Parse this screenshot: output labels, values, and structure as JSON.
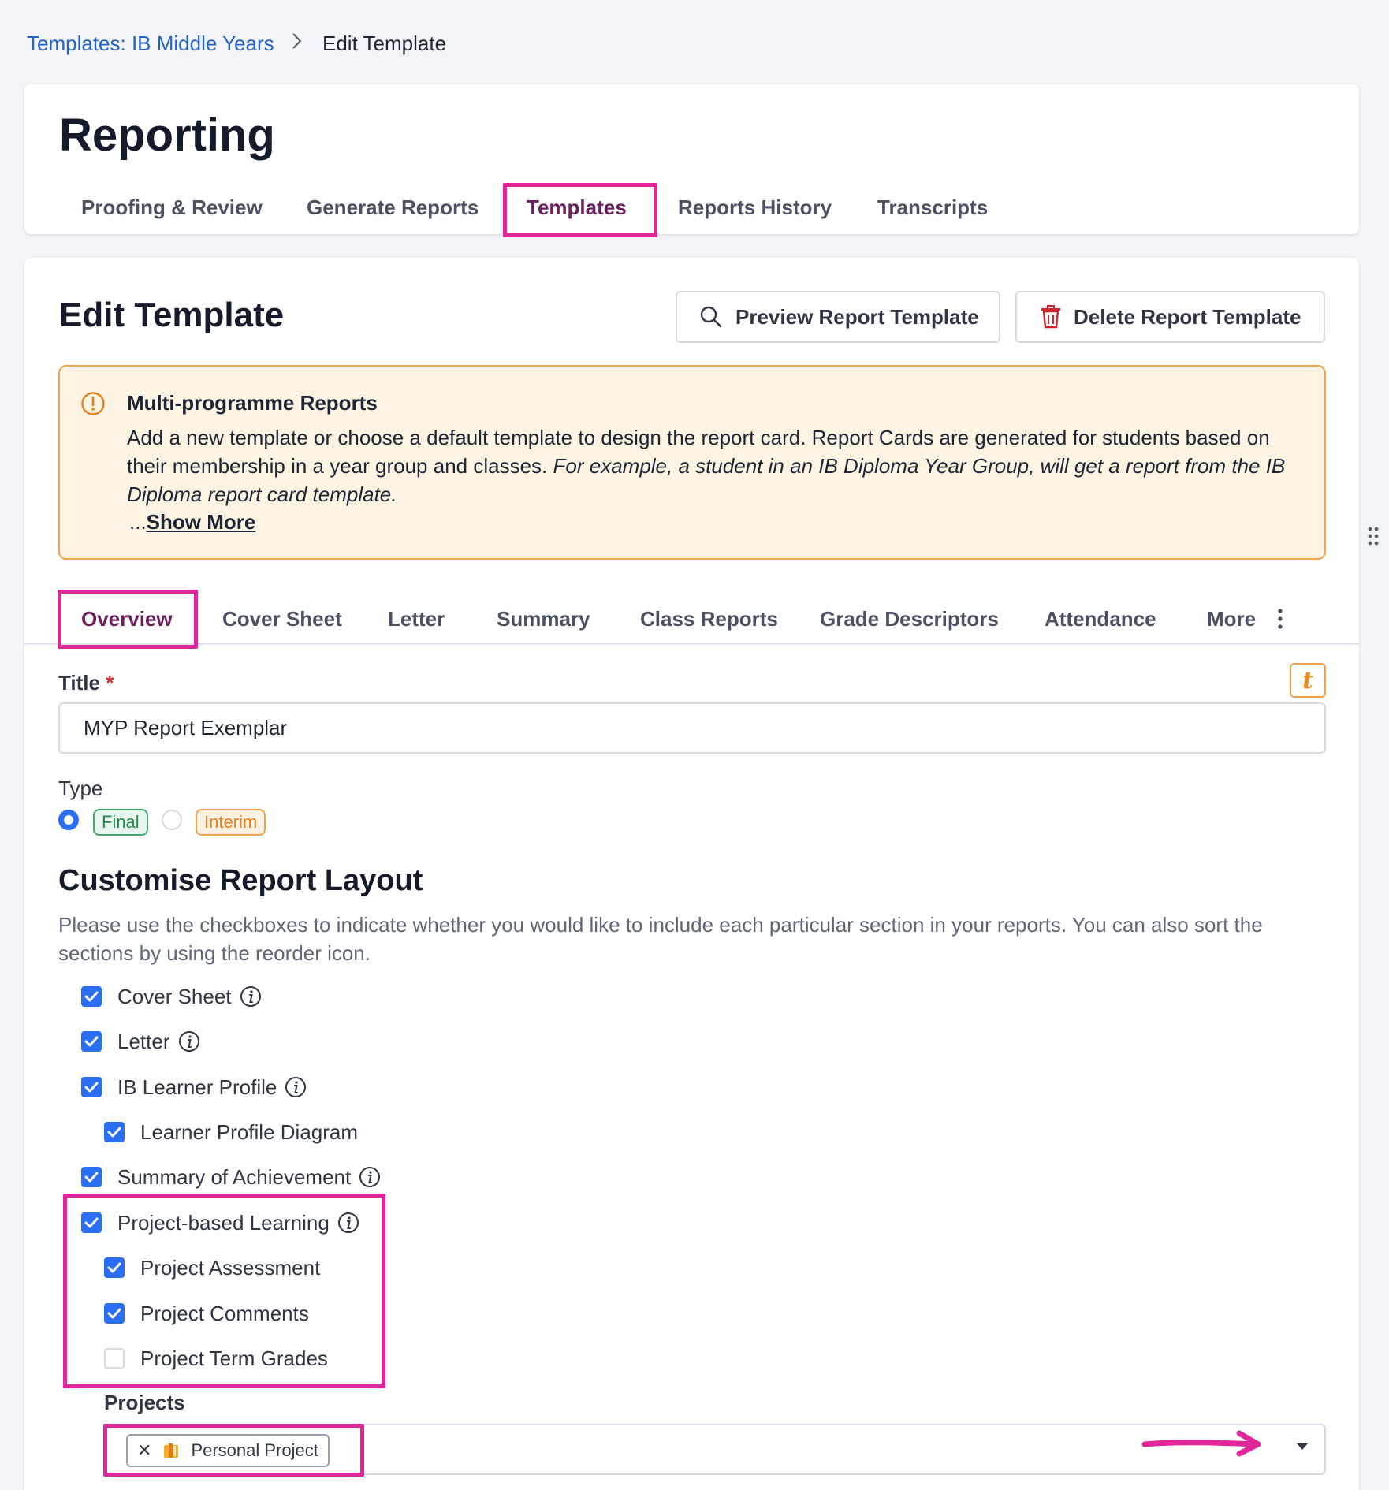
{
  "breadcrumb": {
    "parent": "Templates: IB Middle Years",
    "current": "Edit Template"
  },
  "page": {
    "title": "Reporting"
  },
  "main_tabs": [
    "Proofing & Review",
    "Generate Reports",
    "Templates",
    "Reports History",
    "Transcripts"
  ],
  "active_main_tab": "Templates",
  "edit": {
    "title": "Edit Template",
    "preview_button": "Preview Report Template",
    "delete_button": "Delete Report Template"
  },
  "alert": {
    "title": "Multi-programme Reports",
    "body": "Add a new template or choose a default template to design the report card. Report Cards are generated for students based on their membership in a year group and classes.",
    "body_italic": "For example, a student in an IB Diploma Year Group, will get a report from the IB Diploma report card template.",
    "ellipsis": "...",
    "show_more": "Show More"
  },
  "sub_tabs": [
    "Overview",
    "Cover Sheet",
    "Letter",
    "Summary",
    "Class Reports",
    "Grade Descriptors",
    "Attendance",
    "More"
  ],
  "active_sub_tab": "Overview",
  "form": {
    "title_label": "Title",
    "required_mark": "*",
    "title_value": "MYP Report Exemplar",
    "t_icon": "t",
    "type_label": "Type",
    "type_options": [
      "Final",
      "Interim"
    ],
    "type_selected": "Final"
  },
  "layout": {
    "heading": "Customise Report Layout",
    "description": "Please use the checkboxes to indicate whether you would like to include each particular section in your reports. You can also sort the sections by using the reorder icon.",
    "items": [
      {
        "label": "Cover Sheet",
        "checked": true,
        "indent": 0,
        "info": true
      },
      {
        "label": "Letter",
        "checked": true,
        "indent": 0,
        "info": true
      },
      {
        "label": "IB Learner Profile",
        "checked": true,
        "indent": 0,
        "info": true
      },
      {
        "label": "Learner Profile Diagram",
        "checked": true,
        "indent": 1,
        "info": false
      },
      {
        "label": "Summary of Achievement",
        "checked": true,
        "indent": 0,
        "info": true
      },
      {
        "label": "Project-based Learning",
        "checked": true,
        "indent": 0,
        "info": true
      },
      {
        "label": "Project Assessment",
        "checked": true,
        "indent": 1,
        "info": false
      },
      {
        "label": "Project Comments",
        "checked": true,
        "indent": 1,
        "info": false
      },
      {
        "label": "Project Term Grades",
        "checked": false,
        "indent": 1,
        "info": false
      }
    ],
    "projects_label": "Projects",
    "projects_selected": [
      "Personal Project"
    ]
  },
  "colors": {
    "link": "#2563c9",
    "highlight": "#e0279a",
    "checkbox": "#2a6ff3",
    "alert_bg": "#fdf3e3",
    "alert_border": "#f0a64a"
  }
}
